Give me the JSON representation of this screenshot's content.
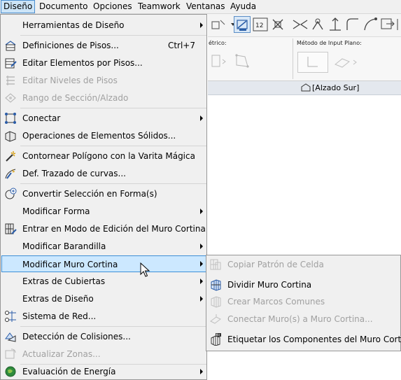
{
  "menubar": {
    "items": [
      "Diseño",
      "Documento",
      "Opciones",
      "Teamwork",
      "Ventanas",
      "Ayuda"
    ],
    "active_index": 0
  },
  "background": {
    "infobox_label_1": "étrico:",
    "infobox_label_2": "Método de Input Plano:",
    "tab_label": "[Alzado Sur]"
  },
  "menu": {
    "items": [
      {
        "label": "Herramientas de Diseño",
        "icon": "none",
        "submenu": true
      },
      {
        "label": "Definiciones de Pisos...",
        "shortcut": "Ctrl+7",
        "icon": "story-settings-icon"
      },
      {
        "label": "Editar Elementos por Pisos...",
        "icon": "edit-elements-stories-icon"
      },
      {
        "label": "Editar Niveles de Pisos",
        "icon": "story-levels-icon",
        "disabled": true
      },
      {
        "label": "Rango de Sección/Alzado",
        "icon": "section-range-icon",
        "disabled": true
      },
      {
        "label": "Conectar",
        "icon": "connect-icon",
        "submenu": true
      },
      {
        "label": "Operaciones de Elementos Sólidos...",
        "icon": "solid-operations-icon"
      },
      {
        "label": "Contornear Polígono con la Varita Mágica",
        "icon": "magic-wand-icon"
      },
      {
        "label": "Def. Trazado de curvas...",
        "icon": "curve-trace-icon"
      },
      {
        "label": "Convertir Selección en Forma(s)",
        "icon": "convert-morph-icon"
      },
      {
        "label": "Modificar Forma",
        "icon": "none",
        "submenu": true
      },
      {
        "label": "Entrar en Modo de Edición del Muro Cortina",
        "icon": "curtain-wall-edit-icon"
      },
      {
        "label": "Modificar Barandilla",
        "icon": "none",
        "submenu": true
      },
      {
        "label": "Modificar Muro Cortina",
        "icon": "none",
        "submenu": true,
        "highlighted": true
      },
      {
        "label": "Extras de Cubiertas",
        "icon": "none",
        "submenu": true
      },
      {
        "label": "Extras de Diseño",
        "icon": "none",
        "submenu": true
      },
      {
        "label": "Sistema de Red...",
        "icon": "grid-system-icon"
      },
      {
        "label": "Detección de Colisiones...",
        "icon": "collision-detection-icon"
      },
      {
        "label": "Actualizar Zonas...",
        "icon": "update-zones-icon",
        "disabled": true
      },
      {
        "label": "Evaluación de Energía",
        "icon": "energy-evaluation-icon",
        "submenu": true
      }
    ]
  },
  "submenu": {
    "items": [
      {
        "label": "Copiar Patrón de Celda",
        "icon": "copy-cell-pattern-icon",
        "disabled": true
      },
      {
        "label": "Dividir Muro Cortina",
        "icon": "split-curtain-wall-icon"
      },
      {
        "label": "Crear  Marcos Comunes",
        "icon": "common-frames-icon",
        "disabled": true
      },
      {
        "label": "Conectar Muro(s) a Muro Cortina...",
        "icon": "connect-wall-icon",
        "disabled": true
      },
      {
        "label": "Etiquetar los Componentes del Muro Cortina",
        "icon": "label-components-icon"
      }
    ]
  },
  "colors": {
    "menu_bg": "#f0f0f0",
    "highlight_bg": "#cce8ff",
    "highlight_border": "#3d8fd6",
    "disabled_text": "#a0a0a0"
  }
}
